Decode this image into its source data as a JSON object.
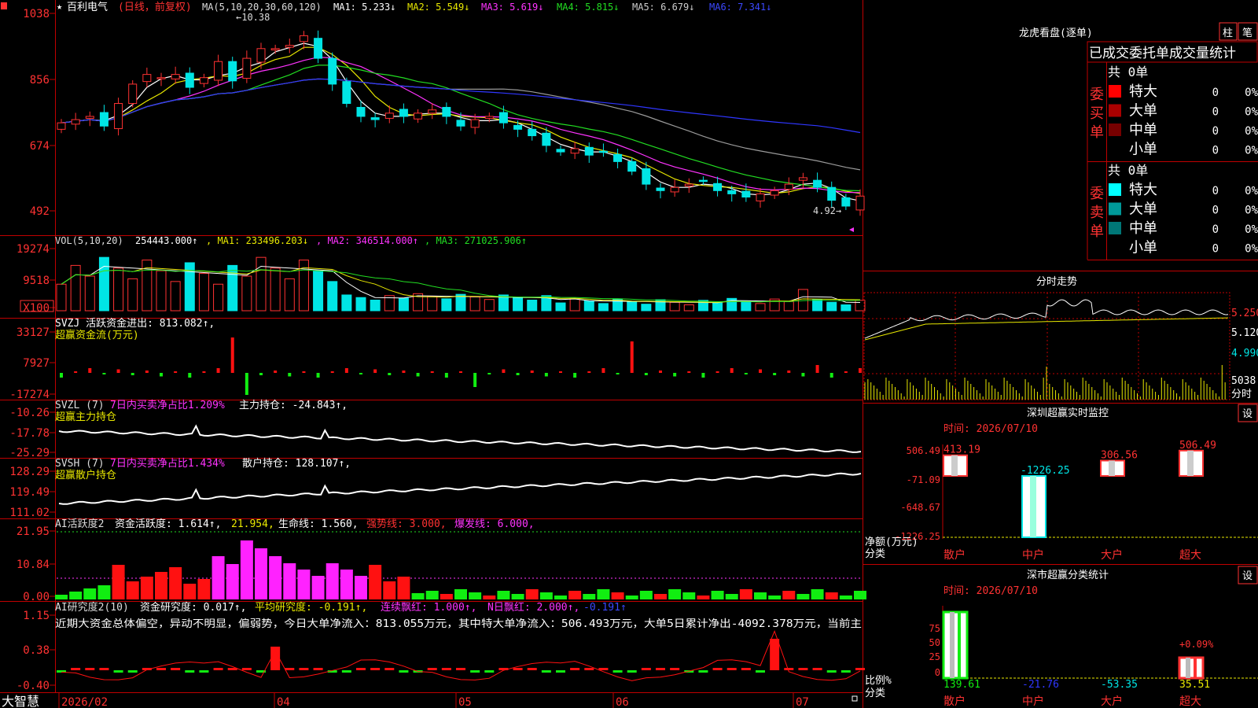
{
  "colors": {
    "up": "#ff3232",
    "down": "#00e5e5",
    "frame": "#c00000",
    "ma1": "#ffffff",
    "ma2": "#e8e800",
    "ma3": "#ff33ff",
    "ma4": "#22dd22",
    "ma5": "#9a9a9a",
    "ma6": "#2f36ff",
    "buy": "#ff1111",
    "sell": "#11ee11",
    "magenta": "#ff22ff",
    "yellow": "#e8e800"
  },
  "main": {
    "star": "★",
    "stock_name": "百利电气",
    "period_label": "(日线，前复权)",
    "ma_params": "MA(5,10,20,30,60,120)",
    "ma_values": [
      {
        "label": "MA1: 5.233↓",
        "color": "#ffffff"
      },
      {
        "label": "MA2: 5.549↓",
        "color": "#e8e800"
      },
      {
        "label": "MA3: 5.619↓",
        "color": "#ff33ff"
      },
      {
        "label": "MA4: 5.815↓",
        "color": "#22dd22"
      },
      {
        "label": "MA5: 6.679↓",
        "color": "#cccccc"
      },
      {
        "label": "MA6: 7.341↓",
        "color": "#3b48ff"
      }
    ],
    "y_ticks": [
      "1038",
      "856",
      "674",
      "492"
    ],
    "high_note": "←10.38",
    "low_note": "4.92→"
  },
  "vol": {
    "header": "VOL(5,10,20)",
    "value": "254443.000↑",
    "ma1": ", MA1: 233496.203↓",
    "ma2": ", MA2: 346514.000↑",
    "ma3": ", MA3: 271025.906↑",
    "y_ticks": [
      "19274",
      "9518",
      "X100"
    ]
  },
  "svzj": {
    "header": "SVZJ  活跃资金进出: 813.082↑,",
    "sub": "超赢资金流(万元)",
    "y_ticks": [
      "33127",
      "7927",
      "-17274"
    ]
  },
  "svzl": {
    "name": "SVZL (7)",
    "ratio": "7日内买卖净占比1.209%",
    "holding": "主力持仓: -24.843↑,",
    "sub": "超赢主力持仓",
    "y_ticks": [
      "-10.26",
      "-17.78",
      "-25.29"
    ]
  },
  "svsh": {
    "name": "SVSH (7)",
    "ratio": "7日内买卖净占比1.434%",
    "holding": "散户持仓: 128.107↑,",
    "sub": "超赢散户持仓",
    "y_ticks": [
      "128.29",
      "119.49",
      "111.02"
    ]
  },
  "ai1": {
    "name": "AI活跃度2",
    "a": "资金活跃度: 1.614↑,",
    "b": "21.954,",
    "c": "生命线: 1.560,",
    "d": "强势线: 3.000,",
    "e": "爆发线: 6.000,",
    "y_ticks": [
      "21.95",
      "10.84",
      "0.00"
    ]
  },
  "ai2": {
    "name": "AI研究度2(10)",
    "a": "资金研究度: 0.017↑,",
    "b": "平均研究度: -0.191↑,",
    "c": "连续飘红: 1.000↑,",
    "d": "N日飘红: 2.000↑,",
    "e": "-0.191↑",
    "text": "近期大资金总体偏空，异动不明显，偏弱势，今日大单净流入：813.055万元，其中特大单净流入：506.493万元，大单5日累计净出-4092.378万元，当前主",
    "y_ticks": [
      "1.15",
      "0.38",
      "-0.40"
    ]
  },
  "xaxis": {
    "logo": "大智慧",
    "labels": [
      "2026/02",
      "04",
      "05",
      "06",
      "07"
    ]
  },
  "dragon": {
    "title": "龙虎看盘(逐单)",
    "btn1": "柱",
    "btn2": "笔",
    "tabs": "已成交委托单成交量统计",
    "buy_label": "委买单",
    "sell_label": "委卖单",
    "buy_total": "共 0单",
    "sell_total": "共 0单",
    "buy_rows": [
      {
        "name": "特大",
        "v": "0",
        "p": "0%",
        "c": "#ff0000"
      },
      {
        "name": "大单",
        "v": "0",
        "p": "0%",
        "c": "#aa0000"
      },
      {
        "name": "中单",
        "v": "0",
        "p": "0%",
        "c": "#770000"
      },
      {
        "name": "小单",
        "v": "0",
        "p": "0%",
        "c": ""
      }
    ],
    "sell_rows": [
      {
        "name": "特大",
        "v": "0",
        "p": "0%",
        "c": "#00ffff"
      },
      {
        "name": "大单",
        "v": "0",
        "p": "0%",
        "c": "#009999"
      },
      {
        "name": "中单",
        "v": "0",
        "p": "0%",
        "c": "#007777"
      },
      {
        "name": "小单",
        "v": "0",
        "p": "0%",
        "c": ""
      }
    ]
  },
  "intraday": {
    "title": "分时走势",
    "y_ticks": [
      "5.250",
      "5.120",
      "4.990"
    ],
    "vol_label": "5038",
    "vol_unit": "分时"
  },
  "monitor1": {
    "title": "深圳超赢实时监控",
    "btn": "设",
    "date": "时间: 2026/07/10",
    "y_ticks": [
      "506.49",
      "-71.09",
      "-648.67",
      "-1226.25"
    ],
    "ylabel": "净额(万元)",
    "xlabel": "分类",
    "categories": [
      "散户",
      "中户",
      "大户",
      "超大"
    ],
    "bar_labels": [
      "413.19",
      "-1226.25",
      "306.56",
      "506.49"
    ]
  },
  "monitor2": {
    "title": "深市超赢分类统计",
    "btn": "设",
    "date": "时间: 2026/07/10",
    "y_ticks": [
      "75",
      "50",
      "25",
      "0"
    ],
    "ylabel": "比例%",
    "xlabel": "分类",
    "categories": [
      "散户",
      "中户",
      "大户",
      "超大"
    ],
    "bottom_values": [
      "139.61",
      "-21.76",
      "-53.35",
      "35.51"
    ],
    "pct_label": "+0.09%"
  },
  "chart_data": [
    {
      "type": "candlestick",
      "title": "百利电气 (日线，前复权)",
      "x_range": [
        "2026/02",
        "2026/07"
      ],
      "ylim": [
        4.92,
        10.38
      ],
      "series": [
        {
          "name": "Close",
          "values": [
            7.5,
            7.6,
            7.7,
            7.4,
            8.1,
            8.7,
            9.0,
            8.9,
            9.0,
            8.6,
            8.9,
            9.4,
            8.8,
            9.5,
            9.8,
            9.8,
            9.9,
            10.2,
            9.5,
            8.7,
            8.1,
            7.7,
            7.6,
            7.8,
            7.7,
            7.8,
            7.9,
            7.7,
            7.4,
            7.6,
            7.7,
            7.5,
            7.3,
            7.1,
            6.8,
            6.6,
            6.7,
            6.5,
            6.6,
            6.3,
            6.0,
            5.6,
            5.4,
            5.5,
            5.6,
            5.7,
            5.4,
            5.3,
            5.2,
            5.3,
            5.4,
            5.6,
            5.8,
            5.5,
            5.1,
            4.92,
            5.23
          ]
        }
      ],
      "ma": {
        "MA1": 5.233,
        "MA2": 5.549,
        "MA3": 5.619,
        "MA4": 5.815,
        "MA5": 6.679,
        "MA6": 7.341
      }
    },
    {
      "type": "bar",
      "title": "VOL(5,10,20)",
      "ylim": [
        0,
        19274
      ],
      "last": 254443.0,
      "ma": {
        "MA1": 233496.203,
        "MA2": 346514.0,
        "MA3": 271025.906
      }
    },
    {
      "type": "bar",
      "title": "深圳超赢实时监控",
      "categories": [
        "散户",
        "中户",
        "大户",
        "超大"
      ],
      "values": [
        413.19,
        -1226.25,
        306.56,
        506.49
      ],
      "ylabel": "净额(万元)",
      "xlabel": "分类",
      "ylim": [
        -1226.25,
        506.49
      ]
    },
    {
      "type": "bar",
      "title": "深市超赢分类统计",
      "categories": [
        "散户",
        "中户",
        "大户",
        "超大"
      ],
      "values": [
        139.61,
        -21.76,
        -53.35,
        35.51
      ],
      "ylabel": "比例%",
      "xlabel": "分类",
      "ylim": [
        0,
        75
      ]
    }
  ]
}
